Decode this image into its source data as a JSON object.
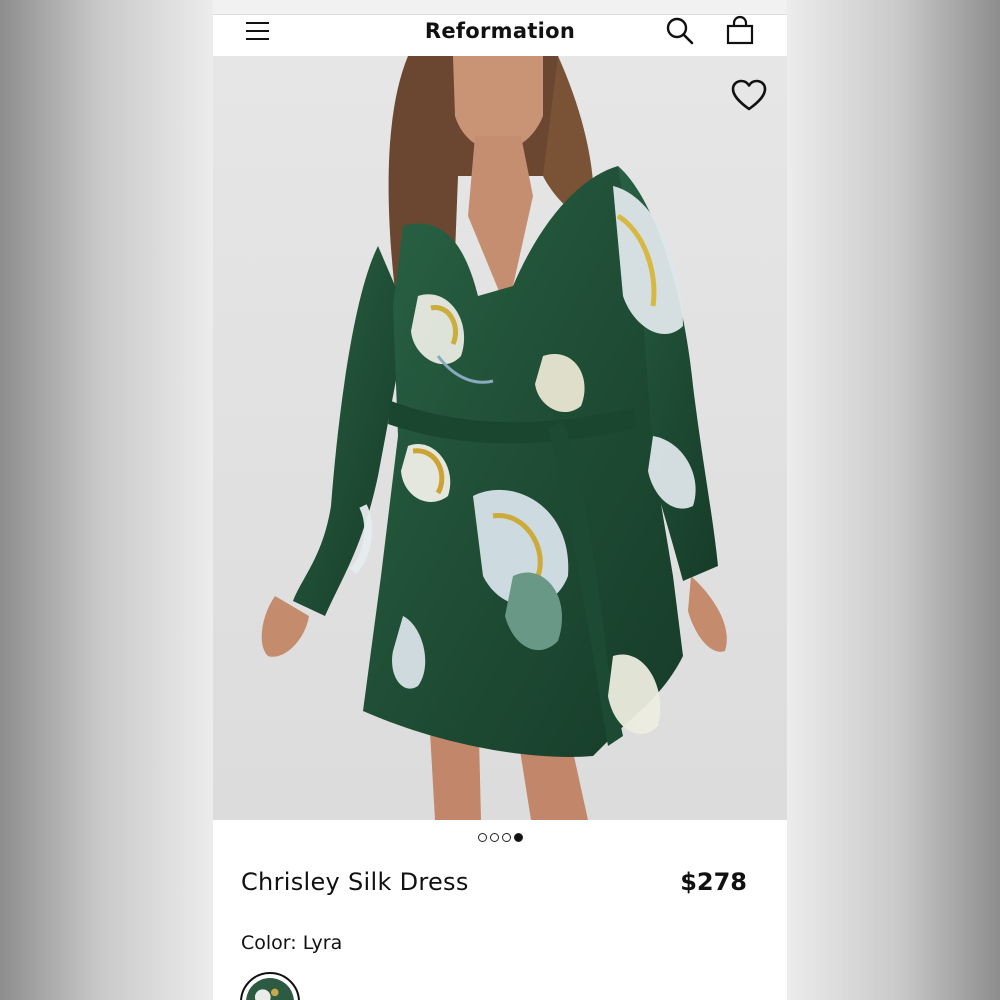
{
  "app": {
    "brand": "Reformation"
  },
  "header": {
    "menu_icon": "hamburger-menu-icon",
    "search_icon": "search-icon",
    "bag_icon": "shopping-bag-icon"
  },
  "gallery": {
    "favorite_icon": "heart-icon",
    "image_count": 4,
    "active_index": 4
  },
  "product": {
    "name": "Chrisley Silk Dress",
    "price": "$278",
    "color_label": "Color: Lyra"
  },
  "colors": {
    "background": "#ffffff",
    "text": "#111111",
    "dress_green": "#1f4d35",
    "photo_backdrop": "#e3e3e3"
  }
}
